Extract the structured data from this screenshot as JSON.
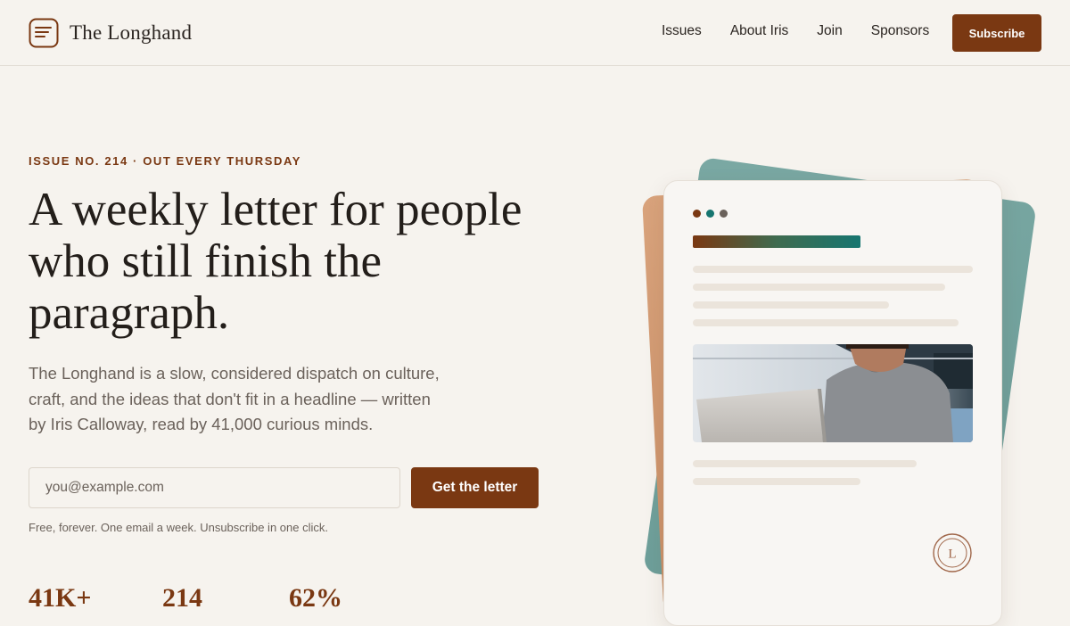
{
  "header": {
    "brand_name": "The Longhand",
    "logo_icon": "note-lines-icon",
    "nav": [
      "Issues",
      "About Iris",
      "Join",
      "Sponsors"
    ],
    "subscribe_label": "Subscribe"
  },
  "hero": {
    "eyebrow": "ISSUE NO. 214 · OUT EVERY THURSDAY",
    "headline": "A weekly letter for people who still finish the paragraph.",
    "lede": "The Longhand is a slow, considered dispatch on culture, craft, and the ideas that don't fit in a headline — written by Iris Calloway, read by 41,000 curious minds.",
    "email_placeholder": "you@example.com",
    "cta_label": "Get the letter",
    "fine_print": "Free, forever. One email a week. Unsubscribe in one click.",
    "stats": [
      "41K+",
      "214",
      "62%"
    ]
  },
  "illustration": {
    "seal_letter": "L",
    "photo_alt": "Man working on a laptop",
    "colors": {
      "accent": "#7a3812",
      "teal": "#177670",
      "peach": "#d9a37c",
      "sage": "#7aa8a3"
    }
  }
}
